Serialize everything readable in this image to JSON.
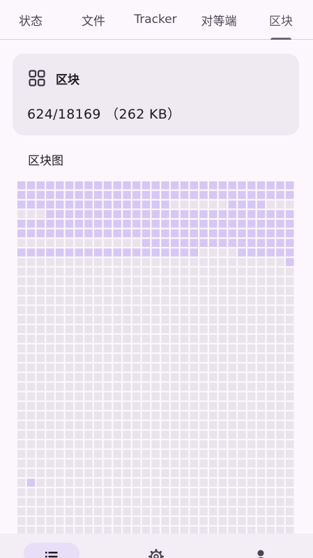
{
  "tabs": [
    {
      "label": "状态",
      "active": false
    },
    {
      "label": "文件",
      "active": false
    },
    {
      "label": "Tracker",
      "active": false
    },
    {
      "label": "对等端",
      "active": false
    },
    {
      "label": "区块",
      "active": true
    }
  ],
  "card": {
    "icon": "grid-icon",
    "title": "区块",
    "value": "624/18169 （262 KB）"
  },
  "blockmap": {
    "label": "区块图",
    "columns": 29,
    "colors": {
      "have": "#d5c8f4",
      "missing": "#e9e4ec"
    },
    "filled_rows": [
      "11111111111111111111111111111",
      "11111111111111111111111111111",
      "11111111111111110000001111000",
      "00011111111111111111111111111",
      "11111111111111111111111111111",
      "11111111111111111111111111111",
      "00000000000001111111111111111",
      "11111111111111111110000111111",
      "00000000000000000000000000001"
    ],
    "extra_filled": [
      [
        31,
        1
      ]
    ],
    "total_rows": 37
  },
  "bottom_nav": [
    {
      "icon": "list-icon",
      "active": true
    },
    {
      "icon": "settings-icon",
      "active": false
    },
    {
      "icon": "person-icon",
      "active": false
    }
  ],
  "colors": {
    "background": "#fcf7fd",
    "card": "#efe9f1",
    "accent": "#6a647a"
  }
}
